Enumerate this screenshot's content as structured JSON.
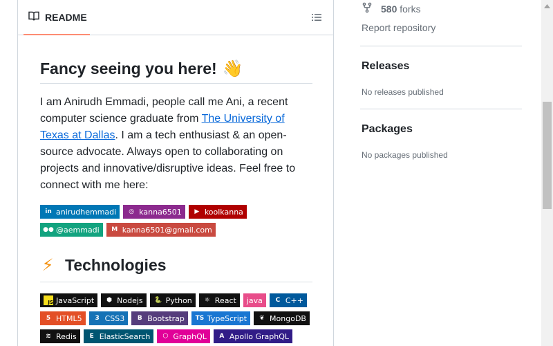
{
  "readme": {
    "tab_label": "README",
    "title": "Fancy seeing you here!",
    "title_emoji": "👋",
    "bio_part1": "I am Anirudh Emmadi, people call me Ani, a recent computer science graduate from ",
    "bio_link": "The University of Texas at Dallas",
    "bio_part2": ". I am a tech enthusiast & an open-source advocate. Always open to collaborating on projects and innovative/disruptive ideas. Feel free to connect with me here:",
    "social_badges": [
      {
        "name": "linkedin",
        "label": "anirudhemmadi",
        "color": "#0077b5",
        "icon": "in"
      },
      {
        "name": "instagram",
        "label": "kanna6501",
        "color": "#8c2a8e",
        "icon": "◎"
      },
      {
        "name": "youtube",
        "label": "koolkanna",
        "color": "#b00000",
        "icon": "▶"
      },
      {
        "name": "medium",
        "label": "@aemmadi",
        "color": "#12a37f",
        "icon": "●●"
      },
      {
        "name": "gmail",
        "label": "kanna6501@gmail.com",
        "color": "#c94a40",
        "icon": "M"
      }
    ],
    "tech_heading": "Technologies",
    "tech_emoji": "⚡",
    "tech_badges": [
      {
        "label": "JavaScript",
        "color": "#111111",
        "icon": "JS"
      },
      {
        "label": "Nodejs",
        "color": "#111111",
        "icon": "⬢"
      },
      {
        "label": "Python",
        "color": "#111111",
        "icon": "🐍"
      },
      {
        "label": "React",
        "color": "#111111",
        "icon": "⚛"
      },
      {
        "label": "java",
        "color": "#e84d8a",
        "icon": ""
      },
      {
        "label": "C++",
        "color": "#00599c",
        "icon": "C"
      },
      {
        "label": "HTML5",
        "color": "#e34f26",
        "icon": "5"
      },
      {
        "label": "CSS3",
        "color": "#1572b6",
        "icon": "3"
      },
      {
        "label": "Bootstrap",
        "color": "#563d7c",
        "icon": "B"
      },
      {
        "label": "TypeScript",
        "color": "#1976d2",
        "icon": "TS"
      },
      {
        "label": "MongoDB",
        "color": "#111111",
        "icon": "❦"
      },
      {
        "label": "Redis",
        "color": "#111111",
        "icon": "≋"
      },
      {
        "label": "ElasticSearch",
        "color": "#005571",
        "icon": "E"
      },
      {
        "label": "GraphQL",
        "color": "#e10098",
        "icon": "⬡"
      },
      {
        "label": "Apollo GraphQL",
        "color": "#311c87",
        "icon": "A"
      }
    ]
  },
  "sidebar": {
    "forks_count": "580",
    "forks_label": "forks",
    "report_label": "Report repository",
    "releases_heading": "Releases",
    "releases_text": "No releases published",
    "packages_heading": "Packages",
    "packages_text": "No packages published"
  }
}
